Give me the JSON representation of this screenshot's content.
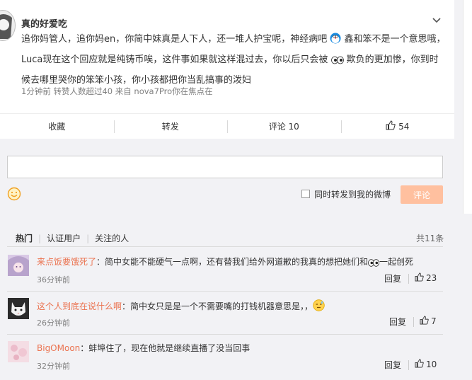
{
  "post": {
    "author": "真的好爱吃",
    "text_part1": "追你妈管人，追你妈en，你简中妹真是人下人，还一堆人护宝呢，神经病吧",
    "text_part2": "鑫和笨不是一个意思哦，Luca现在这个回应就是纯铸币唉，这件事如果就这样混过去，你以后只会被",
    "text_part3": "欺负的更加惨，你到时候去哪里哭你的笨笨小孩，你小孩都把你当乱搞事的泼妇",
    "meta": "1分钟前  转赞人数超过40  来自 nova7Pro你在焦点在"
  },
  "actions": {
    "favorite": "收藏",
    "repost": "转发",
    "comment": "评论 10",
    "like_count": "54"
  },
  "composer": {
    "placeholder": "",
    "repost_label": "同时转发到我的微博",
    "submit_label": "评论"
  },
  "comments_section": {
    "tabs": [
      "热门",
      "认证用户",
      "关注的人"
    ],
    "total": "共11条",
    "items": [
      {
        "user": "来点饭要饿死了",
        "text_a": "：简中女能不能硬气一点啊，还有替我们给外网道歉的我真的想把她们和",
        "text_b": "一起创死",
        "time": "36分钟前",
        "reply": "回复",
        "likes": "23"
      },
      {
        "user": "这个人到底在说什么啊",
        "text_a": "：简中女只是是一个不需要嘴的打钱机器意思是，，",
        "text_b": "",
        "time": "26分钟前",
        "reply": "回复",
        "likes": "7"
      },
      {
        "user": "BigOMoon",
        "text_a": "：蚌埠住了，现在他就是继续直播了没当回事",
        "text_b": "",
        "time": "32分钟前",
        "reply": "回复",
        "likes": "10"
      }
    ]
  },
  "colors": {
    "username": "#eb7350",
    "submit_bg": "#ffc09f",
    "background": "#f2f2f5"
  },
  "icons": {
    "chevron": "chevron-down-icon",
    "like": "thumbs-up-icon",
    "emoji": "smiley-icon",
    "eyes": "eyes-emoji-icon",
    "doraemon": "doraemon-emoji-icon",
    "awkward": "awkward-emoji-icon"
  }
}
